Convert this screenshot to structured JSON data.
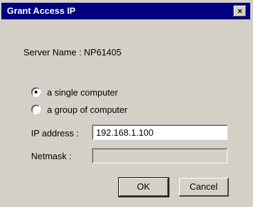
{
  "window": {
    "title": "Grant Access IP",
    "close_glyph": "×"
  },
  "server": {
    "label": "Server Name : NP61405"
  },
  "mode_options": [
    {
      "label": "a single computer",
      "selected": true
    },
    {
      "label": "a group of computer",
      "selected": false
    }
  ],
  "ip": {
    "label": "IP address :",
    "value": "192.168.1.100"
  },
  "netmask": {
    "label": "Netmask :",
    "value": "",
    "enabled": false
  },
  "buttons": {
    "ok": "OK",
    "cancel": "Cancel"
  }
}
